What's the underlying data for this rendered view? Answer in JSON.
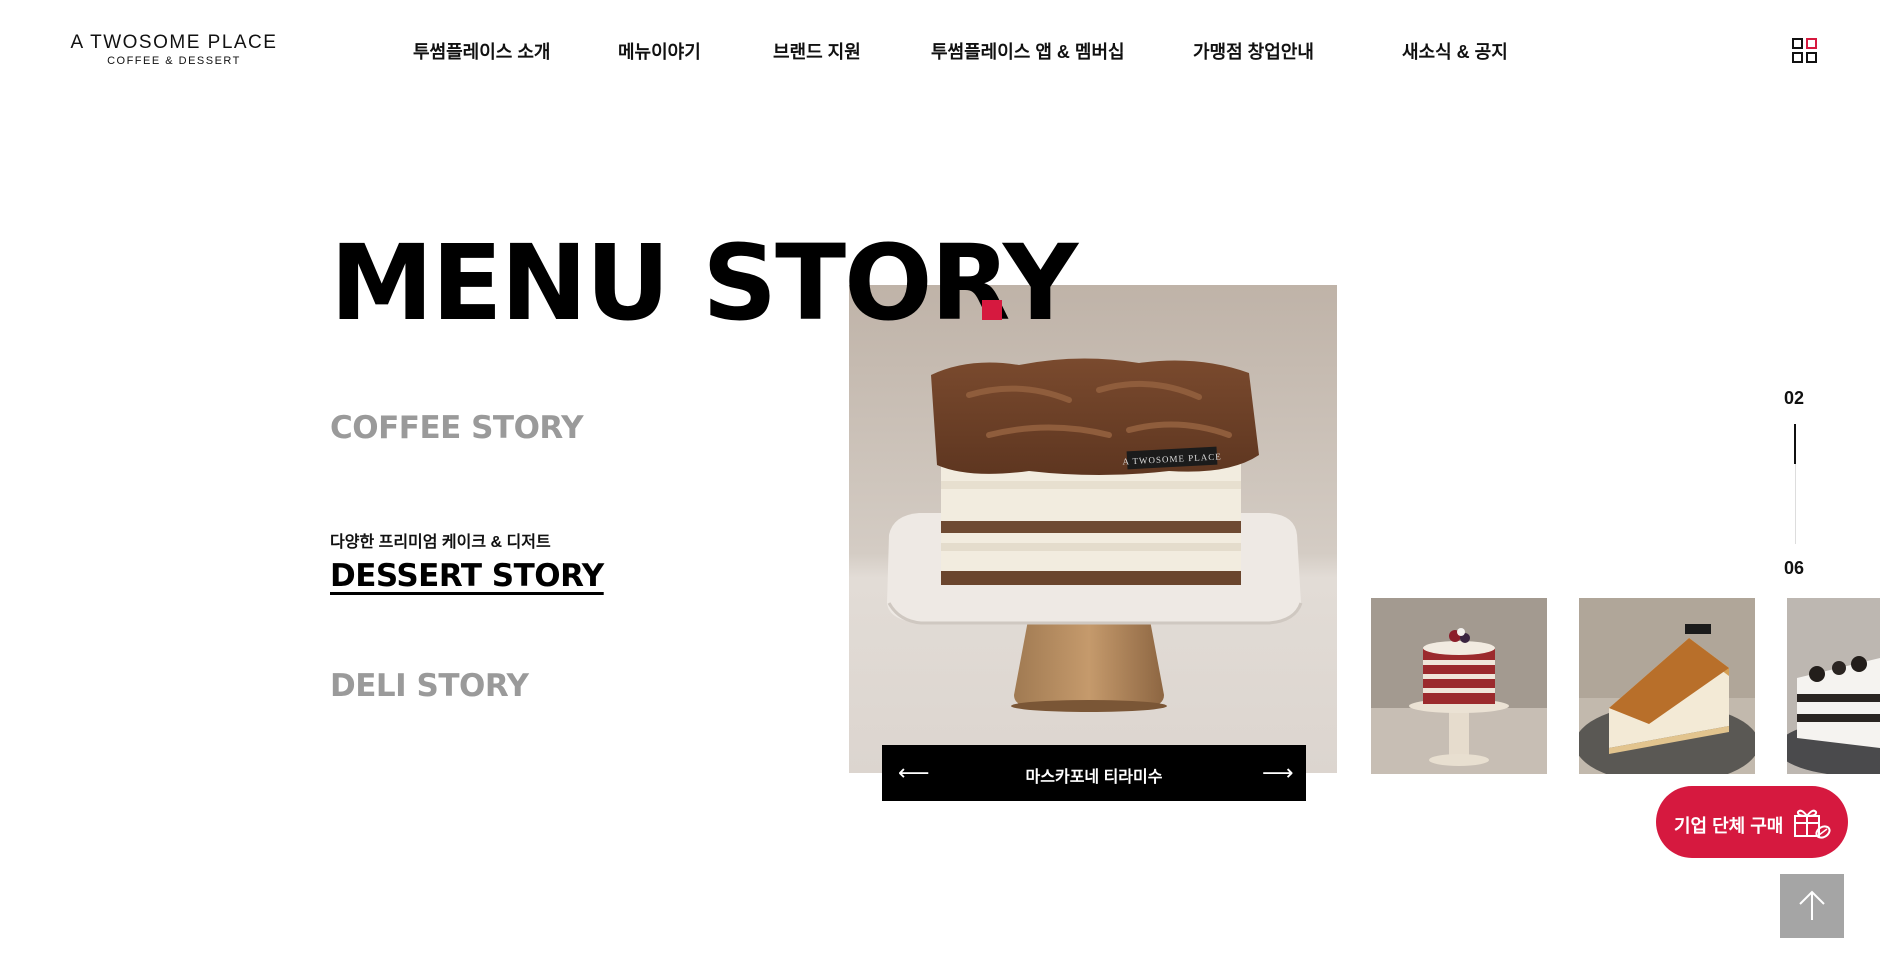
{
  "header": {
    "logo_line1": "A TWOSOME PLACE",
    "logo_line2": "COFFEE & DESSERT",
    "nav": [
      {
        "label": "투썸플레이스 소개"
      },
      {
        "label": "메뉴이야기"
      },
      {
        "label": "브랜드 지원"
      },
      {
        "label": "투썸플레이스 앱 & 멤버십"
      },
      {
        "label": "가맹점 창업안내"
      },
      {
        "label": "새소식 & 공지"
      }
    ],
    "menu_icon": "grid-menu-icon"
  },
  "main": {
    "title": "MENU STORY",
    "accent_color": "#d6193f",
    "categories": {
      "coffee": "COFFEE STORY",
      "dessert_sub": "다양한 프리미엄 케이크 & 디저트",
      "dessert": "DESSERT STORY",
      "deli": "DELI STORY"
    },
    "slider": {
      "current_caption": "마스카포네 티라미수",
      "prev_icon": "arrow-left-icon",
      "next_icon": "arrow-right-icon",
      "current_index": "02",
      "total": "06",
      "progress": 0.33,
      "main_image_label": "A TWOSOME PLACE"
    }
  },
  "floating": {
    "corp_button_label": "기업 단체 구매",
    "corp_button_icon": "gift-box-icon",
    "top_button_icon": "arrow-up-icon"
  }
}
